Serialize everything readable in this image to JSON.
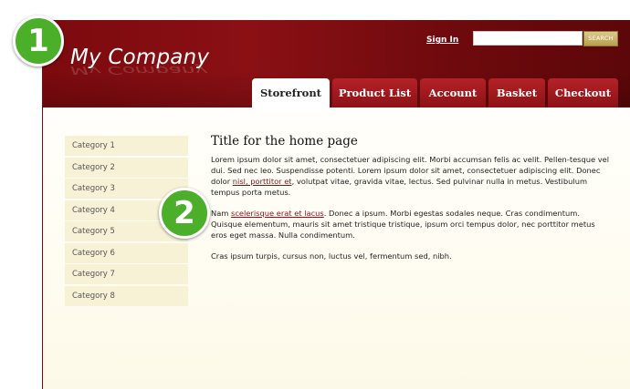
{
  "header": {
    "logo_text": "My Company",
    "signin_label": "Sign In",
    "search_button_label": "SEARCH",
    "search_value": ""
  },
  "tabs": [
    {
      "label": "Storefront",
      "active": true
    },
    {
      "label": "Product List"
    },
    {
      "label": "Account"
    },
    {
      "label": "Basket"
    },
    {
      "label": "Checkout"
    }
  ],
  "sidebar": {
    "categories": [
      "Category 1",
      "Category 2",
      "Category 3",
      "Category 4",
      "Category 5",
      "Category 6",
      "Category 7",
      "Category 8"
    ]
  },
  "main": {
    "title": "Title for the home page",
    "p1_a": "Lorem ipsum dolor sit amet, consectetuer adipiscing elit. Morbi accumsan felis ac velit. Pellen-tesque vel dui. Sed nec leo. Suspendisse potenti. Lorem ipsum dolor sit amet, consectetuer adipiscing elit. Donec dolor ",
    "p1_link": "nisl, porttitor et",
    "p1_b": ", volutpat vitae, gravida vitae, lectus. Sed pulvinar nulla in metus. Vestibulum tempus porta metus.",
    "p2_a": "Nam ",
    "p2_link": "scelerisque erat et lacus",
    "p2_b": ". Donec a ipsum. Morbi egestas sodales neque. Cras condimentum. Quisque elementum, mauris sit amet tristique tristique, ipsum orci tempus dolor, nec porttitor metus eros eget massa. Nulla condimentum.",
    "p3": "Cras ipsum turpis, cursus non, luctus vel, fermentum sed, nibh."
  },
  "annotations": [
    "1",
    "2"
  ],
  "colors": {
    "header_red": "#7c0a0e",
    "tab_red": "#a51b21",
    "badge_green": "#4caf29",
    "sidebar_bg": "#f7f1d6"
  }
}
